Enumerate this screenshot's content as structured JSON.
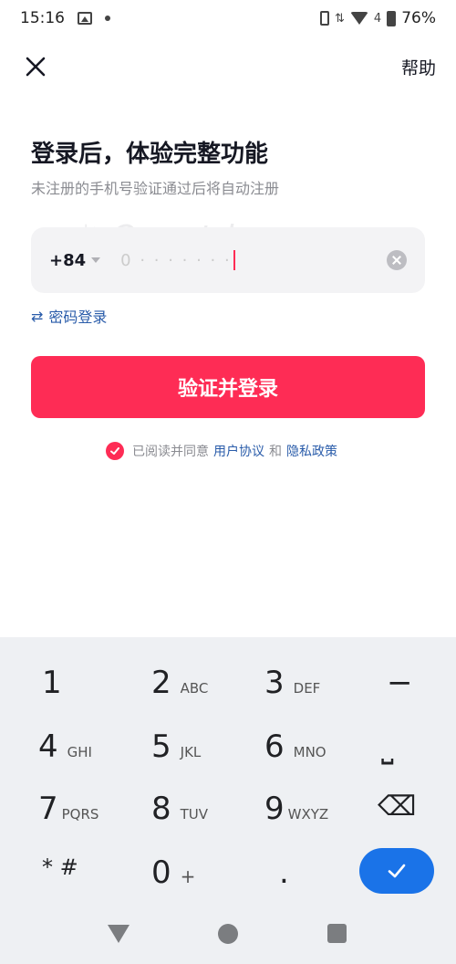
{
  "status_bar": {
    "time": "15:16",
    "battery": "76%",
    "data_indicator": "4"
  },
  "header": {
    "close_icon": "close-icon",
    "help_label": "帮助"
  },
  "main": {
    "title": "登录后，体验完整功能",
    "subtitle": "未注册的手机号验证通过后将自动注册",
    "phone": {
      "country_code": "+84",
      "value": "0 · · · · · · ·"
    },
    "password_login_label": "密码登录",
    "submit_label": "验证并登录",
    "agreement": {
      "prefix": "已阅读并同意",
      "user_agreement": "用户协议",
      "conjunction": "和",
      "privacy_policy": "隐私政策"
    }
  },
  "watermark": "Quantrimang",
  "keyboard": {
    "keys": [
      {
        "num": "1",
        "sub": ""
      },
      {
        "num": "2",
        "sub": "ABC"
      },
      {
        "num": "3",
        "sub": "DEF"
      },
      {
        "num": "−",
        "sub": ""
      },
      {
        "num": "4",
        "sub": "GHI"
      },
      {
        "num": "5",
        "sub": "JKL"
      },
      {
        "num": "6",
        "sub": "MNO"
      },
      {
        "num": "⎵",
        "sub": ""
      },
      {
        "num": "7",
        "sub": "PQRS"
      },
      {
        "num": "8",
        "sub": "TUV"
      },
      {
        "num": "9",
        "sub": "WXYZ"
      },
      {
        "num": "⌫",
        "sub": ""
      },
      {
        "num": "* #",
        "sub": ""
      },
      {
        "num": "0",
        "sub": "+"
      },
      {
        "num": ".",
        "sub": ""
      }
    ]
  },
  "colors": {
    "accent": "#fe2c55",
    "link": "#2a5caa",
    "keyboard_done": "#1a73e8"
  }
}
